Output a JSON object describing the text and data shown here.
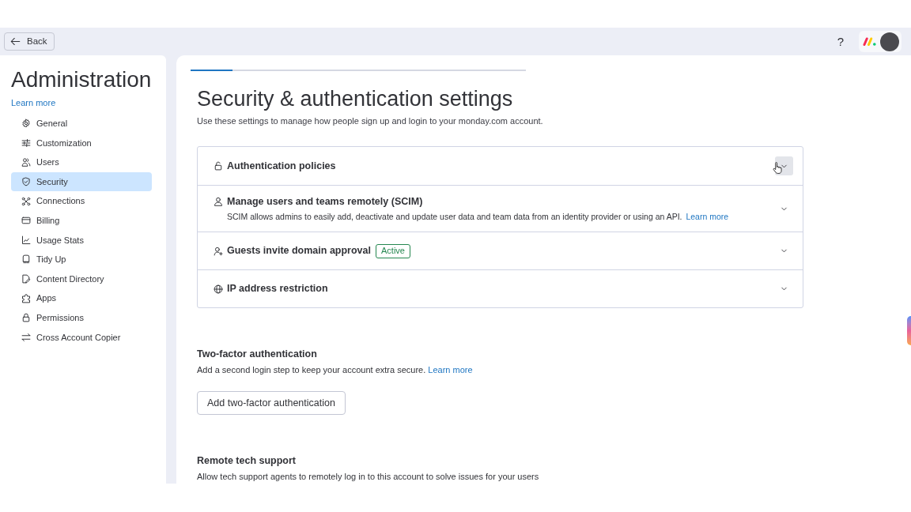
{
  "top_bar": {
    "back_button": "Back",
    "help_button": "?"
  },
  "sidebar": {
    "title": "Administration",
    "learn_more": "Learn more",
    "items": [
      {
        "label": "General",
        "selected": false
      },
      {
        "label": "Customization",
        "selected": false
      },
      {
        "label": "Users",
        "selected": false
      },
      {
        "label": "Security",
        "selected": true
      },
      {
        "label": "Connections",
        "selected": false
      },
      {
        "label": "Billing",
        "selected": false
      },
      {
        "label": "Usage Stats",
        "selected": false
      },
      {
        "label": "Tidy Up",
        "selected": false
      },
      {
        "label": "Content Directory",
        "selected": false
      },
      {
        "label": "Apps",
        "selected": false
      },
      {
        "label": "Permissions",
        "selected": false
      },
      {
        "label": "Cross Account Copier",
        "selected": false
      }
    ]
  },
  "main": {
    "progress": {
      "level": 0.125
    },
    "title": "Security & authentication settings",
    "subtitle": "Use these settings to manage how people sign up and login to your monday.com account.",
    "policies": [
      {
        "title": "Authentication policies",
        "expanded": false,
        "hovered": true
      },
      {
        "title": "Manage users and teams remotely (SCIM)",
        "description": "SCIM allows admins to easily add, deactivate and update user data and team data from an identity provider or using an API.",
        "link": "Learn more",
        "expanded": false,
        "hovered": false
      },
      {
        "title": "Guests invite domain approval",
        "badge": "Active",
        "expanded": false,
        "hovered": false
      },
      {
        "title": "IP address restriction",
        "expanded": false,
        "hovered": false
      }
    ],
    "sections": [
      {
        "heading": "Two-factor authentication",
        "description": "Add a second login step to keep your account extra secure.",
        "link": "Learn more",
        "button": "Add two-factor authentication"
      },
      {
        "heading": "Remote tech support",
        "description": "Allow tech support agents to remotely log in to this account to solve issues for your users"
      }
    ]
  }
}
